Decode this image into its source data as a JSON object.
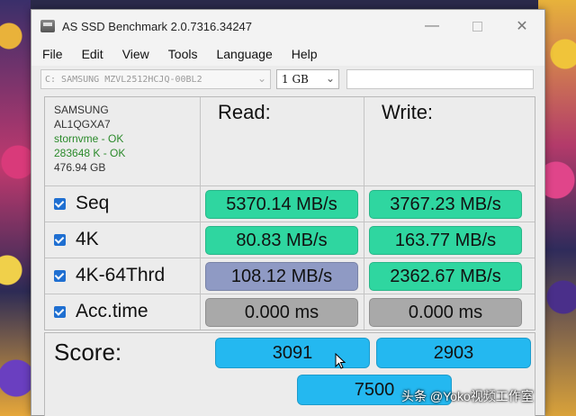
{
  "window": {
    "title": "AS SSD Benchmark 2.0.7316.34247",
    "controls": {
      "minimize": "—",
      "close": "✕"
    }
  },
  "menu": [
    "File",
    "Edit",
    "View",
    "Tools",
    "Language",
    "Help"
  ],
  "toolbar": {
    "drive": "C: SAMSUNG MZVL2512HCJQ-00BL2",
    "size": "1 GB"
  },
  "info": {
    "vendor": "SAMSUNG",
    "firmware": "AL1QGXA7",
    "driver": "stornvme - OK",
    "alignment": "283648 K - OK",
    "capacity": "476.94 GB"
  },
  "columns": {
    "read": "Read:",
    "write": "Write:"
  },
  "rows": [
    {
      "label": "Seq",
      "read": "5370.14 MB/s",
      "write": "3767.23 MB/s"
    },
    {
      "label": "4K",
      "read": "80.83 MB/s",
      "write": "163.77 MB/s"
    },
    {
      "label": "4K-64Thrd",
      "read": "108.12 MB/s",
      "write": "2362.67 MB/s"
    },
    {
      "label": "Acc.time",
      "read": "0.000 ms",
      "write": "0.000 ms"
    }
  ],
  "score": {
    "label": "Score:",
    "read": "3091",
    "write": "2903",
    "total": "7500"
  },
  "colors": {
    "green": "#2fd6a0",
    "blue_gray": "#8f9ac4",
    "gray": "#a9a9a9",
    "cyan": "#24b8f0"
  },
  "watermark": "头条 @Yoko视频工作室"
}
